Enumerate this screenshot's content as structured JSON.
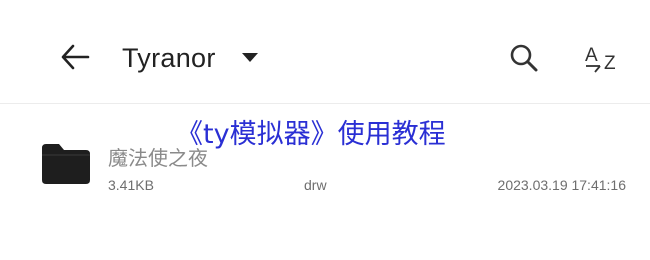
{
  "toolbar": {
    "back_icon": "arrow-left-icon",
    "folder_name": "Tyranor",
    "dropdown_icon": "caret-down-icon",
    "search_icon": "search-icon",
    "sort_icon": "sort-az-icon",
    "sort_label_top": "A",
    "sort_label_bottom": "Z"
  },
  "overlay": {
    "title": "《ty模拟器》使用教程",
    "color": "#2a2fd4"
  },
  "files": [
    {
      "icon": "folder-icon",
      "name": "魔法使之夜",
      "size": "3.41KB",
      "permissions": "drw",
      "modified": "2023.03.19 17:41:16"
    }
  ]
}
